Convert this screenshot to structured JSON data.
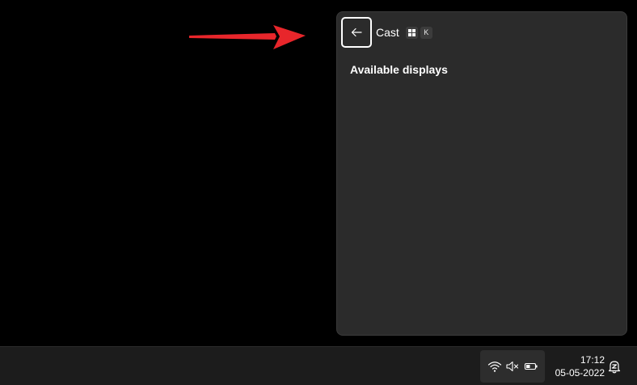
{
  "flyout": {
    "title": "Cast",
    "shortcut_key": "K",
    "section_heading": "Available displays"
  },
  "taskbar": {
    "time": "17:12",
    "date": "05-05-2022"
  },
  "icons": {
    "back": "arrow-left-icon",
    "windows_key": "windows-logo-icon",
    "wifi": "wifi-icon",
    "volume": "volume-muted-icon",
    "battery": "battery-icon",
    "notifications": "notification-bell-icon",
    "annotation": "red-arrow"
  },
  "colors": {
    "flyout_bg": "#2b2b2b",
    "taskbar_bg": "#1c1c1c",
    "tray_bg": "#2d2d2d",
    "annotation_arrow": "#e8262b",
    "text": "#ffffff"
  }
}
